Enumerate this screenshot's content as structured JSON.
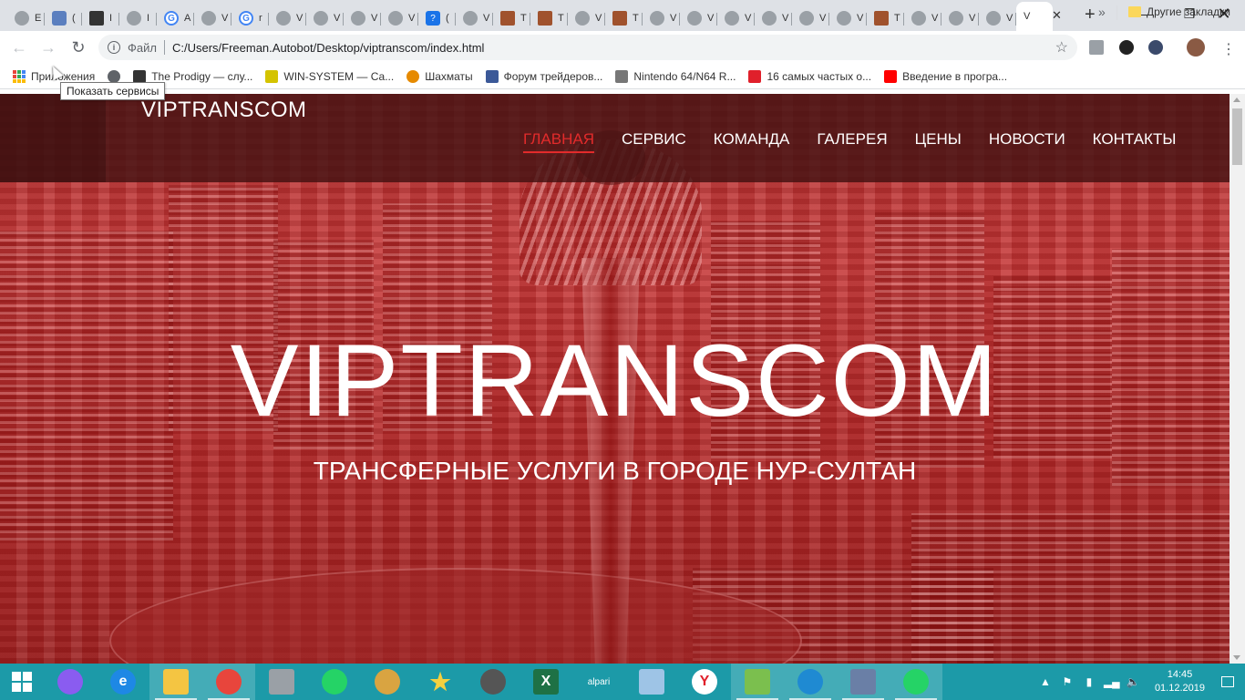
{
  "browser": {
    "tabs": [
      {
        "icon": "globe",
        "title": "E"
      },
      {
        "icon": "translate",
        "title": "("
      },
      {
        "icon": "image",
        "title": "I"
      },
      {
        "icon": "cap",
        "title": "I"
      },
      {
        "icon": "google",
        "title": "А"
      },
      {
        "icon": "globe",
        "title": "V"
      },
      {
        "icon": "google",
        "title": "r"
      },
      {
        "icon": "globe",
        "title": "V"
      },
      {
        "icon": "globe",
        "title": "V"
      },
      {
        "icon": "globe",
        "title": "V"
      },
      {
        "icon": "globe",
        "title": "V"
      },
      {
        "icon": "question",
        "title": "("
      },
      {
        "icon": "globe",
        "title": "V"
      },
      {
        "icon": "squares",
        "title": "T"
      },
      {
        "icon": "squares",
        "title": "T"
      },
      {
        "icon": "globe",
        "title": "V"
      },
      {
        "icon": "squares",
        "title": "T"
      },
      {
        "icon": "globe",
        "title": "V"
      },
      {
        "icon": "globe",
        "title": "V"
      },
      {
        "icon": "globe",
        "title": "V"
      },
      {
        "icon": "globe",
        "title": "V"
      },
      {
        "icon": "globe",
        "title": "V"
      },
      {
        "icon": "globe",
        "title": "V"
      },
      {
        "icon": "squares",
        "title": "T"
      },
      {
        "icon": "globe",
        "title": "V"
      },
      {
        "icon": "globe",
        "title": "V"
      },
      {
        "icon": "globe",
        "title": "V"
      }
    ],
    "active_tab_title": "V",
    "address": {
      "scheme_label": "Файл",
      "url": "C:/Users/Freeman.Autobot/Desktop/viptranscom/index.html"
    },
    "bookmarks": [
      {
        "label": "Приложения",
        "icon": "apps-grid"
      },
      {
        "label": "",
        "icon": "globe"
      },
      {
        "label": "The Prodigy — слу...",
        "icon": "pause"
      },
      {
        "label": "WIN-SYSTEM — Са...",
        "icon": "win-system"
      },
      {
        "label": "Шахматы",
        "icon": "chess"
      },
      {
        "label": "Форум трейдеров...",
        "icon": "cap"
      },
      {
        "label": "Nintendo 64/N64 R...",
        "icon": "cartridge"
      },
      {
        "label": "16 самых частых о...",
        "icon": "heart"
      },
      {
        "label": "Введение в програ...",
        "icon": "youtube"
      }
    ],
    "other_bookmarks": "Другие закладки",
    "tooltip": "Показать сервисы"
  },
  "site": {
    "brand": "VIPTRANSCOM",
    "menu": [
      {
        "label": "ГЛАВНАЯ",
        "active": true
      },
      {
        "label": "СЕРВИС",
        "active": false
      },
      {
        "label": "КОМАНДА",
        "active": false
      },
      {
        "label": "ГАЛЕРЕЯ",
        "active": false
      },
      {
        "label": "ЦЕНЫ",
        "active": false
      },
      {
        "label": "НОВОСТИ",
        "active": false
      },
      {
        "label": "КОНТАКТЫ",
        "active": false
      }
    ],
    "hero_title": "VIPTRANSCOM",
    "hero_subtitle": "ТРАНСФЕРНЫЕ УСЛУГИ В ГОРОДЕ НУР-СУЛТАН"
  },
  "taskbar": {
    "apps": [
      {
        "name": "alice",
        "glyph": "",
        "color": "#8a5cf0"
      },
      {
        "name": "internet-explorer",
        "glyph": "e",
        "color": "#1e88e5"
      },
      {
        "name": "file-explorer",
        "glyph": "",
        "color": "#f4c542",
        "open": true
      },
      {
        "name": "chrome",
        "glyph": "",
        "color": "#e8453c",
        "open": true
      },
      {
        "name": "calculator",
        "glyph": "",
        "color": "#9aa0a6"
      },
      {
        "name": "whatsapp",
        "glyph": "",
        "color": "#25d366"
      },
      {
        "name": "paint",
        "glyph": "",
        "color": "#d9a441"
      },
      {
        "name": "favorites-star",
        "glyph": "★",
        "color": "transparent"
      },
      {
        "name": "camera-app",
        "glyph": "",
        "color": "#555"
      },
      {
        "name": "excel",
        "glyph": "X",
        "color": "#1e7145"
      },
      {
        "name": "alpari",
        "glyph": "alpari",
        "color": "transparent"
      },
      {
        "name": "3d-box",
        "glyph": "",
        "color": "#9ec4e6"
      },
      {
        "name": "yandex-browser",
        "glyph": "Y",
        "color": "#ffffff"
      },
      {
        "name": "notepad-plus",
        "glyph": "",
        "color": "#7bbf4e",
        "open": true
      },
      {
        "name": "vscode",
        "glyph": "",
        "color": "#1f8ad2",
        "open": true
      },
      {
        "name": "remote-desktop",
        "glyph": "",
        "color": "#6a7fa6",
        "open": true
      },
      {
        "name": "whatsapp-desktop",
        "glyph": "",
        "color": "#25d366",
        "open": true
      }
    ],
    "clock_time": "14:45",
    "clock_date": "01.12.2019"
  }
}
